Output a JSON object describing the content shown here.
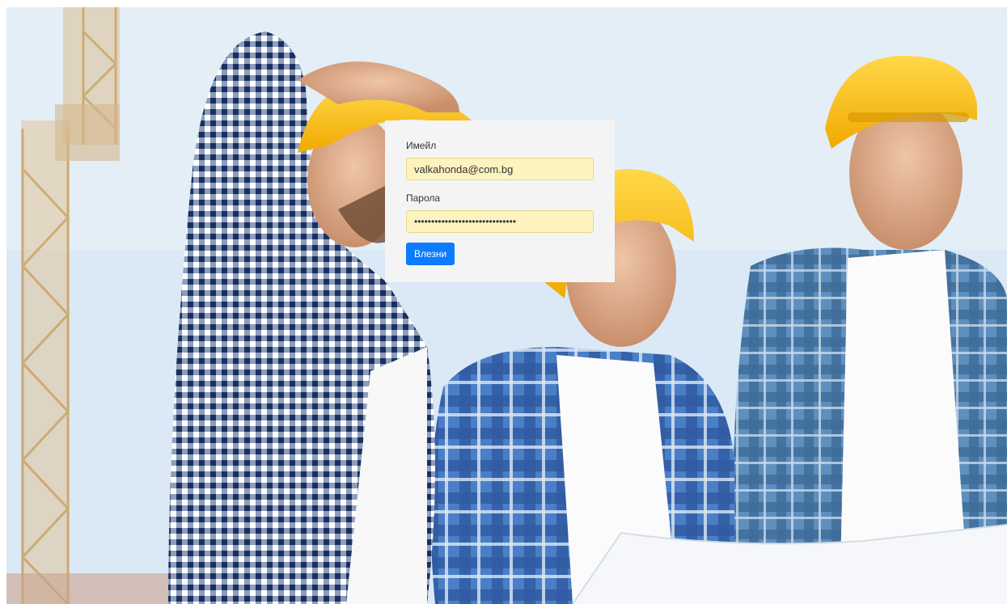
{
  "login": {
    "email_label": "Имейл",
    "email_value": "valkahonda@com.bg",
    "password_label": "Парола",
    "password_value": "••••••••••••••••••••••••••••••",
    "submit_label": "Влезни"
  },
  "colors": {
    "button": "#0b7bff",
    "input_autofill": "#fdf3bf",
    "card_background": "#f4f4f4"
  }
}
